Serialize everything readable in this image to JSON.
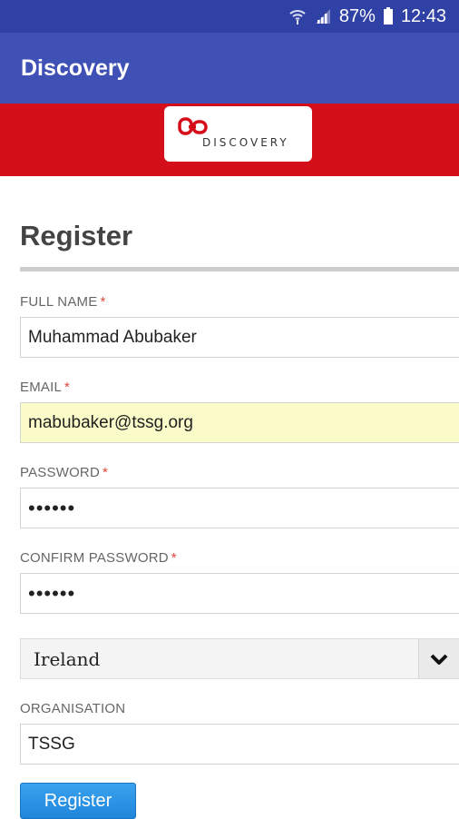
{
  "status_bar": {
    "battery": "87%",
    "time": "12:43",
    "icons": [
      "wifi-icon",
      "signal-icon",
      "battery-icon"
    ]
  },
  "app_bar": {
    "title": "Discovery"
  },
  "banner": {
    "logo_text": "DISCOVERY",
    "color": "#d50f1a"
  },
  "form": {
    "title": "Register",
    "required_mark": "*",
    "fields": {
      "full_name": {
        "label": "FULL NAME",
        "value": "Muhammad Abubaker"
      },
      "email": {
        "label": "EMAIL",
        "value": "mabubaker@tssg.org"
      },
      "password": {
        "label": "PASSWORD",
        "value": "••••••"
      },
      "confirm_password": {
        "label": "CONFIRM PASSWORD",
        "value": "••••••"
      },
      "country": {
        "value": "Ireland"
      },
      "organisation": {
        "label": "ORGANISATION",
        "value": "TSSG"
      }
    },
    "submit_label": "Register"
  },
  "colors": {
    "status_bar": "#3041a6",
    "app_bar": "#3f51b5",
    "button": "#2790e3",
    "required": "#e0453b",
    "autofill": "#fafbc8"
  }
}
